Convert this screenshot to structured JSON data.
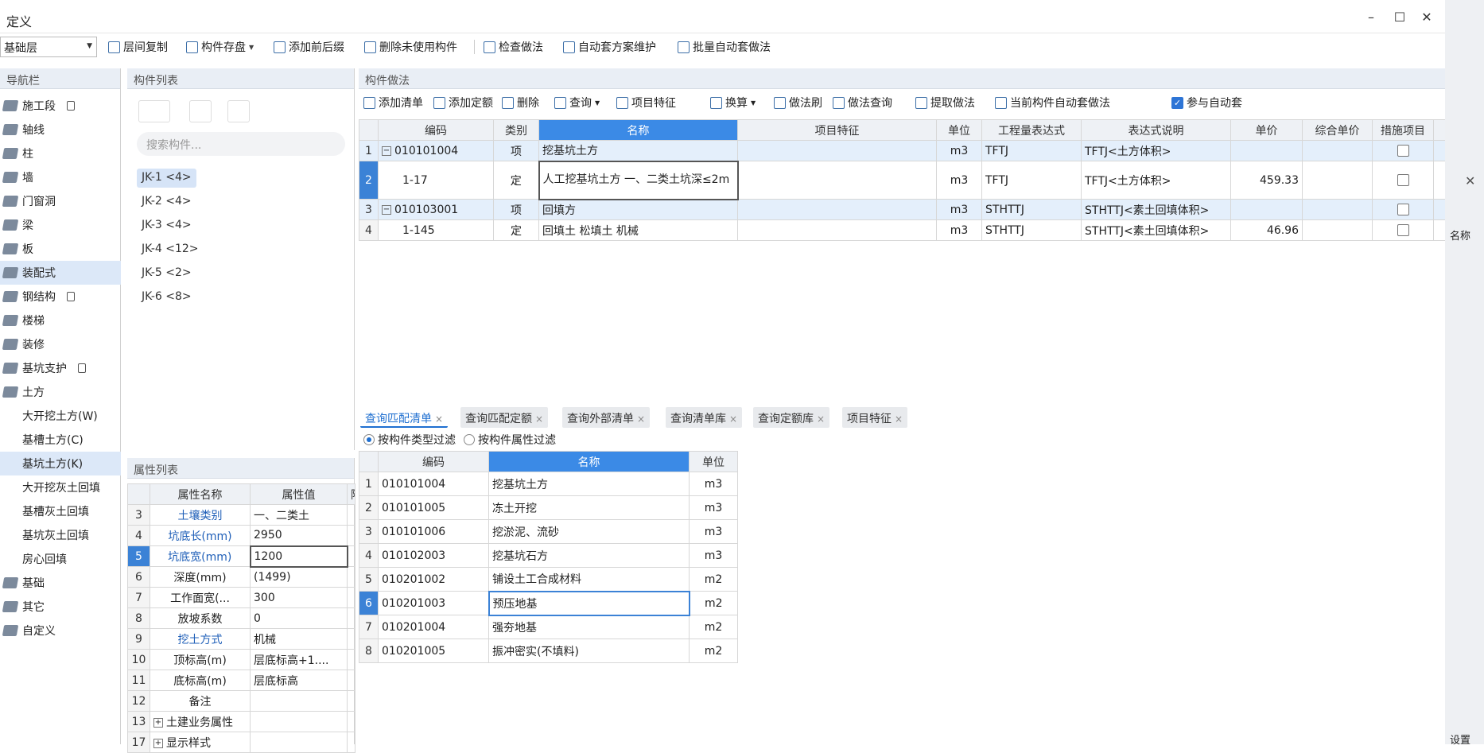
{
  "window": {
    "title": "定义",
    "minimize": "–",
    "maximize": "☐",
    "close": "✕"
  },
  "toolbar": {
    "floor": "基础层",
    "buttons": [
      "层间复制",
      "构件存盘",
      "添加前后缀",
      "删除未使用构件",
      "检查做法",
      "自动套方案维护",
      "批量自动套做法"
    ]
  },
  "nav": {
    "title": "导航栏",
    "items": [
      {
        "label": "施工段",
        "lock": true
      },
      {
        "label": "轴线"
      },
      {
        "label": "柱"
      },
      {
        "label": "墙"
      },
      {
        "label": "门窗洞"
      },
      {
        "label": "梁"
      },
      {
        "label": "板"
      },
      {
        "label": "装配式",
        "selected": true
      },
      {
        "label": "钢结构",
        "lock": true
      },
      {
        "label": "楼梯"
      },
      {
        "label": "装修"
      },
      {
        "label": "基坑支护",
        "lock": true
      },
      {
        "label": "土方"
      }
    ],
    "sub_items": [
      {
        "label": "大开挖土方(W)"
      },
      {
        "label": "基槽土方(C)"
      },
      {
        "label": "基坑土方(K)",
        "selected": true
      },
      {
        "label": "大开挖灰土回填"
      },
      {
        "label": "基槽灰土回填"
      },
      {
        "label": "基坑灰土回填"
      },
      {
        "label": "房心回填"
      }
    ],
    "tail_items": [
      {
        "label": "基础"
      },
      {
        "label": "其它"
      },
      {
        "label": "自定义"
      }
    ]
  },
  "components": {
    "title": "构件列表",
    "search_placeholder": "搜索构件...",
    "items": [
      "JK-1 <4>",
      "JK-2 <4>",
      "JK-3 <4>",
      "JK-4 <12>",
      "JK-5 <2>",
      "JK-6 <8>"
    ]
  },
  "props": {
    "title": "属性列表",
    "headers": [
      "属性名称",
      "属性值",
      "附"
    ],
    "rows": [
      {
        "n": "3",
        "name": "土壤类别",
        "value": "一、二类土",
        "blue": true
      },
      {
        "n": "4",
        "name": "坑底长(mm)",
        "value": "2950",
        "blue": true
      },
      {
        "n": "5",
        "name": "坑底宽(mm)",
        "value": "1200",
        "blue": true,
        "sel": true
      },
      {
        "n": "6",
        "name": "深度(mm)",
        "value": "(1499)"
      },
      {
        "n": "7",
        "name": "工作面宽(...",
        "value": "300"
      },
      {
        "n": "8",
        "name": "放坡系数",
        "value": "0"
      },
      {
        "n": "9",
        "name": "挖土方式",
        "value": "机械",
        "blue": true
      },
      {
        "n": "10",
        "name": "顶标高(m)",
        "value": "层底标高+1...."
      },
      {
        "n": "11",
        "name": "底标高(m)",
        "value": "层底标高"
      },
      {
        "n": "12",
        "name": "备注",
        "value": ""
      },
      {
        "n": "13",
        "name": "土建业务属性",
        "value": "",
        "group": true
      },
      {
        "n": "17",
        "name": "显示样式",
        "value": "",
        "group": true
      }
    ]
  },
  "method": {
    "title": "构件做法",
    "toolbar": [
      "添加清单",
      "添加定额",
      "删除",
      "查询",
      "项目特征",
      "换算",
      "做法刷",
      "做法查询",
      "提取做法",
      "当前构件自动套做法"
    ],
    "auto_label": "参与自动套",
    "headers": [
      "编码",
      "类别",
      "名称",
      "项目特征",
      "单位",
      "工程量表达式",
      "表达式说明",
      "单价",
      "综合单价",
      "措施项目"
    ],
    "rows": [
      {
        "n": "1",
        "code": "010101004",
        "type": "项",
        "name": "挖基坑土方",
        "feature": "",
        "unit": "m3",
        "expr": "TFTJ",
        "desc": "TFTJ<土方体积>",
        "price": "",
        "total": "",
        "group": true
      },
      {
        "n": "2",
        "code": "1-17",
        "type": "定",
        "name": "人工挖基坑土方 一、二类土坑深≤2m",
        "feature": "",
        "unit": "m3",
        "expr": "TFTJ",
        "desc": "TFTJ<土方体积>",
        "price": "459.33",
        "total": "",
        "sel": true
      },
      {
        "n": "3",
        "code": "010103001",
        "type": "项",
        "name": "回填方",
        "feature": "",
        "unit": "m3",
        "expr": "STHTTJ",
        "desc": "STHTTJ<素土回填体积>",
        "price": "",
        "total": "",
        "group": true
      },
      {
        "n": "4",
        "code": "1-145",
        "type": "定",
        "name": "回填土 松填土 机械",
        "feature": "",
        "unit": "m3",
        "expr": "STHTTJ",
        "desc": "STHTTJ<素土回填体积>",
        "price": "46.96",
        "total": ""
      }
    ]
  },
  "query": {
    "tabs": [
      "查询匹配清单",
      "查询匹配定额",
      "查询外部清单",
      "查询清单库",
      "查询定额库",
      "项目特征"
    ],
    "filter1": "按构件类型过滤",
    "filter2": "按构件属性过滤",
    "headers": [
      "编码",
      "名称",
      "单位"
    ],
    "rows": [
      {
        "n": "1",
        "code": "010101004",
        "name": "挖基坑土方",
        "unit": "m3"
      },
      {
        "n": "2",
        "code": "010101005",
        "name": "冻土开挖",
        "unit": "m3"
      },
      {
        "n": "3",
        "code": "010101006",
        "name": "挖淤泥、流砂",
        "unit": "m3"
      },
      {
        "n": "4",
        "code": "010102003",
        "name": "挖基坑石方",
        "unit": "m3"
      },
      {
        "n": "5",
        "code": "010201002",
        "name": "铺设土工合成材料",
        "unit": "m2"
      },
      {
        "n": "6",
        "code": "010201003",
        "name": "预压地基",
        "unit": "m2",
        "sel": true
      },
      {
        "n": "7",
        "code": "010201004",
        "name": "强夯地基",
        "unit": "m2"
      },
      {
        "n": "8",
        "code": "010201005",
        "name": "振冲密实(不填料)",
        "unit": "m2"
      }
    ]
  },
  "right": {
    "label1": "名称",
    "label2": "设置"
  }
}
